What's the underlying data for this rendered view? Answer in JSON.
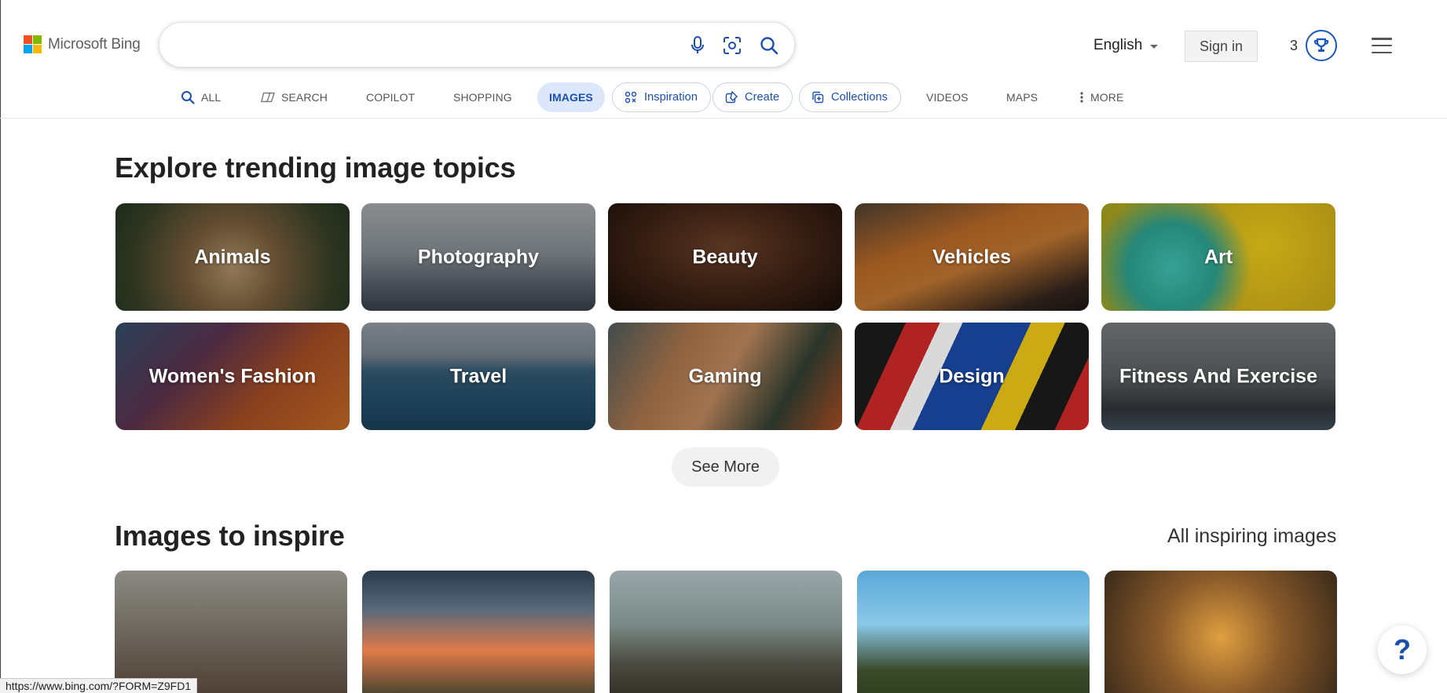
{
  "header": {
    "logo_text": "Microsoft Bing",
    "search": {
      "value": "",
      "placeholder": ""
    },
    "language": "English",
    "signin_label": "Sign in",
    "rewards_count": "3"
  },
  "nav": {
    "items": [
      {
        "label": "ALL",
        "icon": "search-icon"
      },
      {
        "label": "SEARCH",
        "icon": "copilot-search-icon"
      },
      {
        "label": "COPILOT"
      },
      {
        "label": "SHOPPING"
      },
      {
        "label": "IMAGES",
        "active": true
      },
      {
        "label": "Inspiration",
        "icon": "inspiration-icon"
      },
      {
        "label": "Create",
        "icon": "create-icon"
      },
      {
        "label": "Collections",
        "icon": "collections-icon"
      },
      {
        "label": "VIDEOS"
      },
      {
        "label": "MAPS"
      },
      {
        "label": "MORE",
        "icon": "more-vertical-icon"
      }
    ]
  },
  "trending": {
    "title": "Explore trending image topics",
    "topics": [
      "Animals",
      "Photography",
      "Beauty",
      "Vehicles",
      "Art",
      "Women's Fashion",
      "Travel",
      "Gaming",
      "Design",
      "Fitness And Exercise"
    ],
    "see_more_label": "See More"
  },
  "inspire": {
    "title": "Images to inspire",
    "all_link": "All inspiring images"
  },
  "status_bar": {
    "url": "https://www.bing.com/?FORM=Z9FD1"
  },
  "help": {
    "label": "?"
  },
  "colors": {
    "accent": "#1a4fae",
    "active_pill": "#dde7fb"
  }
}
